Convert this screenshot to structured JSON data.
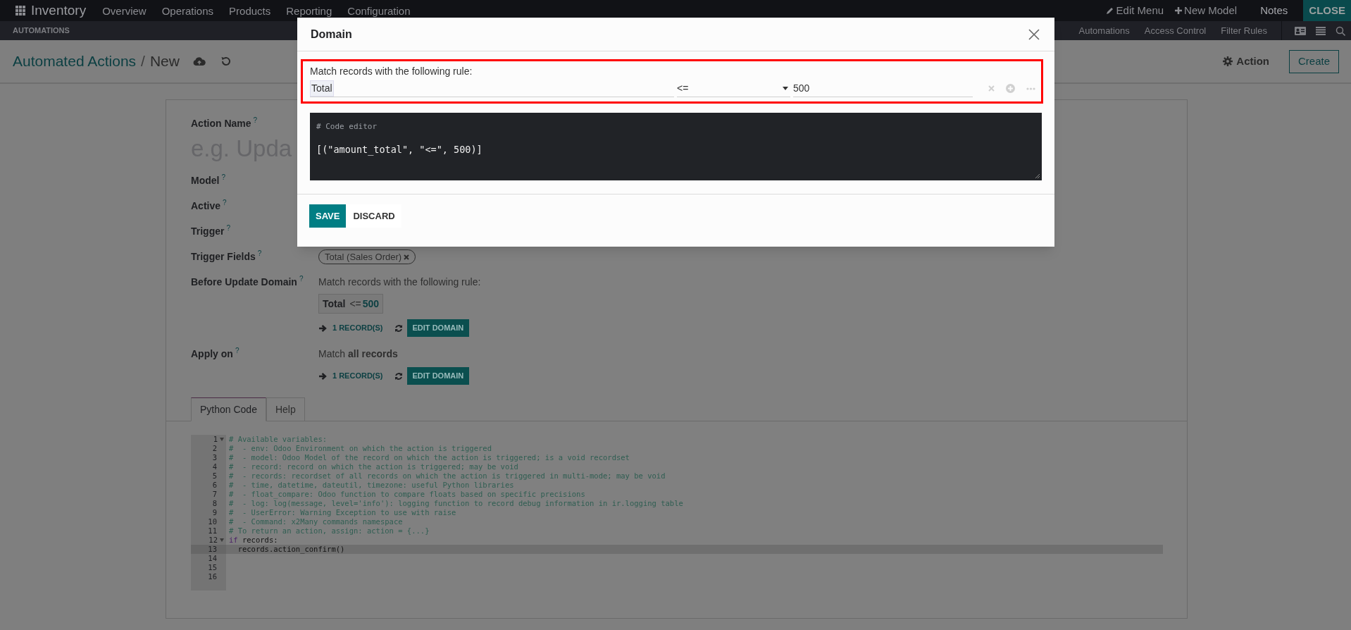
{
  "top_nav": {
    "app": "Inventory",
    "menu": [
      "Overview",
      "Operations",
      "Products",
      "Reporting",
      "Configuration"
    ],
    "right": [
      {
        "kind": "edit",
        "label": "Edit Menu"
      },
      {
        "kind": "new",
        "label": "New Model"
      },
      {
        "kind": "plain",
        "label": "Notes"
      },
      {
        "kind": "close",
        "label": "CLOSE"
      }
    ]
  },
  "sub_nav": {
    "title": "AUTOMATIONS",
    "menu": [
      "Automations",
      "Access Control",
      "Filter Rules"
    ]
  },
  "breadcrumb": {
    "parent": "Automated Actions",
    "separator": "/",
    "current": "New"
  },
  "control_buttons": {
    "action": "Action",
    "create": "Create"
  },
  "form": {
    "fields": [
      {
        "kind": "title",
        "label": "Action Name",
        "help": "?",
        "placeholder": "e.g. Upda"
      },
      {
        "kind": "plain",
        "label": "Model",
        "help": "?"
      },
      {
        "kind": "plain",
        "label": "Active",
        "help": "?"
      },
      {
        "kind": "plain",
        "label": "Trigger",
        "help": "?"
      },
      {
        "kind": "tags",
        "label": "Trigger Fields",
        "help": "?",
        "tags": [
          "Total (Sales Order)"
        ]
      },
      {
        "kind": "domain",
        "label": "Before Update Domain",
        "help": "?",
        "summary": "Match records with the following rule:",
        "rule": {
          "field": "Total",
          "operator": "<=",
          "value": "500"
        },
        "records": "1 RECORD(S)",
        "edit": "EDIT DOMAIN"
      },
      {
        "kind": "domain",
        "label": "Apply on",
        "help": "?",
        "summary": "Match **all records**",
        "records": "1 RECORD(S)",
        "edit": "EDIT DOMAIN"
      }
    ]
  },
  "tabs": [
    {
      "label": "Python Code",
      "selected": true
    },
    {
      "label": "Help",
      "selected": false
    }
  ],
  "code": {
    "lines": [
      {
        "number": "1",
        "foldable": true,
        "selected": false,
        "tokens": [
          {
            "kind": "comment",
            "text": "# Available variables:"
          }
        ]
      },
      {
        "number": "2",
        "foldable": false,
        "selected": false,
        "tokens": [
          {
            "kind": "comment",
            "text": "#  - env: Odoo Environment on which the action is triggered"
          }
        ]
      },
      {
        "number": "3",
        "foldable": false,
        "selected": false,
        "tokens": [
          {
            "kind": "comment",
            "text": "#  - model: Odoo Model of the record on which the action is triggered; is a void recordset"
          }
        ]
      },
      {
        "number": "4",
        "foldable": false,
        "selected": false,
        "tokens": [
          {
            "kind": "comment",
            "text": "#  - record: record on which the action is triggered; may be void"
          }
        ]
      },
      {
        "number": "5",
        "foldable": false,
        "selected": false,
        "tokens": [
          {
            "kind": "comment",
            "text": "#  - records: recordset of all records on which the action is triggered in multi-mode; may be void"
          }
        ]
      },
      {
        "number": "6",
        "foldable": false,
        "selected": false,
        "tokens": [
          {
            "kind": "comment",
            "text": "#  - time, datetime, dateutil, timezone: useful Python libraries"
          }
        ]
      },
      {
        "number": "7",
        "foldable": false,
        "selected": false,
        "tokens": [
          {
            "kind": "comment",
            "text": "#  - float_compare: Odoo function to compare floats based on specific precisions"
          }
        ]
      },
      {
        "number": "8",
        "foldable": false,
        "selected": false,
        "tokens": [
          {
            "kind": "comment",
            "text": "#  - log: log(message, level='info'): logging function to record debug information in ir.logging table"
          }
        ]
      },
      {
        "number": "9",
        "foldable": false,
        "selected": false,
        "tokens": [
          {
            "kind": "comment",
            "text": "#  - UserError: Warning Exception to use with raise"
          }
        ]
      },
      {
        "number": "10",
        "foldable": false,
        "selected": false,
        "tokens": [
          {
            "kind": "comment",
            "text": "#  - Command: x2Many commands namespace"
          }
        ]
      },
      {
        "number": "11",
        "foldable": false,
        "selected": false,
        "tokens": [
          {
            "kind": "comment",
            "text": "# To return an action, assign: action = {...}"
          }
        ]
      },
      {
        "number": "12",
        "foldable": true,
        "selected": false,
        "tokens": [
          {
            "kind": "keyword",
            "text": "if"
          },
          {
            "kind": "plain",
            "text": " records:"
          }
        ]
      },
      {
        "number": "13",
        "foldable": false,
        "selected": true,
        "tokens": [
          {
            "kind": "plain",
            "text": "  records.action_confirm()"
          }
        ]
      },
      {
        "number": "14",
        "foldable": false,
        "selected": false
      },
      {
        "number": "15",
        "foldable": false,
        "selected": false
      },
      {
        "number": "16",
        "foldable": false,
        "selected": false
      }
    ]
  },
  "modal": {
    "title": "Domain",
    "intro": "Match records with the following rule:",
    "rule": {
      "field": "Total",
      "operator": "<=",
      "value": "500"
    },
    "code_comment": "# Code editor",
    "code": "[(\"amount_total\", \"<=\", 500)]",
    "buttons": [
      {
        "kind": "primary",
        "label": "SAVE"
      },
      {
        "kind": "secondary",
        "label": "DISCARD"
      }
    ]
  }
}
